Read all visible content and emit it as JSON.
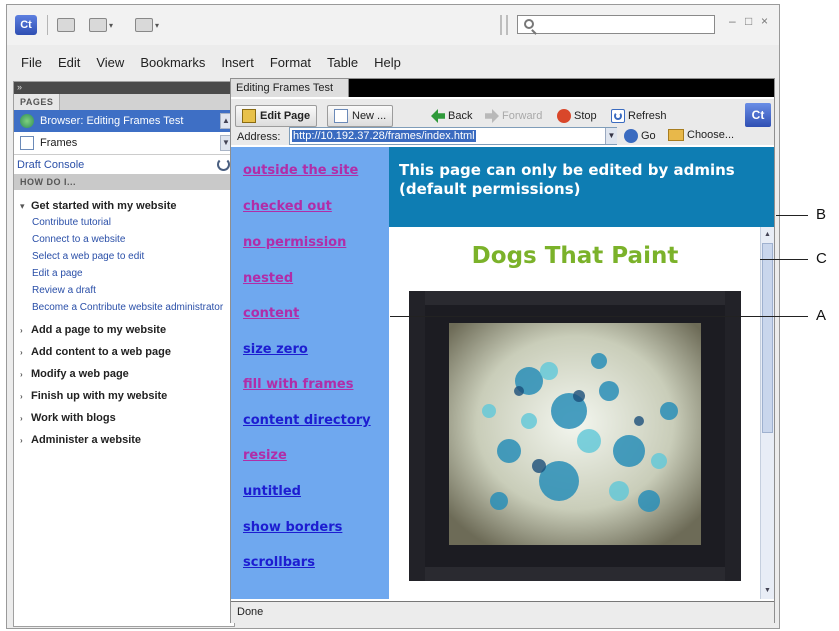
{
  "app": {
    "logo": "Ct"
  },
  "search": {
    "placeholder": ""
  },
  "menu": [
    "File",
    "Edit",
    "View",
    "Bookmarks",
    "Insert",
    "Format",
    "Table",
    "Help"
  ],
  "pages_panel": {
    "header": "PAGES",
    "items": [
      {
        "label": "Browser: Editing Frames Test",
        "icon": "globe-icon",
        "selected": true
      },
      {
        "label": "Frames",
        "icon": "page-icon",
        "selected": false
      }
    ],
    "draft_console": "Draft Console"
  },
  "howdo_panel": {
    "header": "HOW DO I...",
    "sections": [
      {
        "title": "Get started with my website",
        "expanded": true,
        "links": [
          "Contribute tutorial",
          "Connect to a website",
          "Select a web page to edit",
          "Edit a page",
          "Review a draft",
          "Become a Contribute website administrator"
        ]
      },
      {
        "title": "Add a page to my website",
        "expanded": false
      },
      {
        "title": "Add content to a web page",
        "expanded": false
      },
      {
        "title": "Modify a web page",
        "expanded": false
      },
      {
        "title": "Finish up with my website",
        "expanded": false
      },
      {
        "title": "Work with blogs",
        "expanded": false
      },
      {
        "title": "Administer a website",
        "expanded": false
      }
    ]
  },
  "document_tab": "Editing Frames Test",
  "browser_toolbar": {
    "edit_page": "Edit Page",
    "new": "New ...",
    "back": "Back",
    "forward": "Forward",
    "stop": "Stop",
    "refresh": "Refresh",
    "logo": "Ct"
  },
  "address": {
    "label": "Address:",
    "value": "http://10.192.37.28/frames/index.html",
    "go": "Go",
    "choose": "Choose..."
  },
  "nav_frame": {
    "links": [
      {
        "label": "outside the site",
        "visited": true
      },
      {
        "label": "checked out",
        "visited": true
      },
      {
        "label": "no permission",
        "visited": true
      },
      {
        "label": "nested",
        "visited": true
      },
      {
        "label": "content",
        "visited": true
      },
      {
        "label": "size zero",
        "visited": false
      },
      {
        "label": "fill with frames",
        "visited": true
      },
      {
        "label": "content directory",
        "visited": false
      },
      {
        "label": "resize",
        "visited": true
      },
      {
        "label": "untitled",
        "visited": false
      },
      {
        "label": "show borders",
        "visited": false
      },
      {
        "label": "scrollbars",
        "visited": false
      }
    ]
  },
  "header_frame": {
    "line1": "This page can only be edited by admins",
    "line2": "(default permissions)"
  },
  "content_frame": {
    "title": "Dogs That Paint"
  },
  "status": "Done",
  "callouts": [
    "A",
    "B",
    "C"
  ],
  "colors": {
    "nav_frame_bg": "#6fa8ef",
    "header_frame_bg": "#0e7db3",
    "title_green": "#7bb22a",
    "visited_link": "#b12da8",
    "unvisited_link": "#1d1dd1",
    "selection_blue": "#3e6fc5"
  }
}
